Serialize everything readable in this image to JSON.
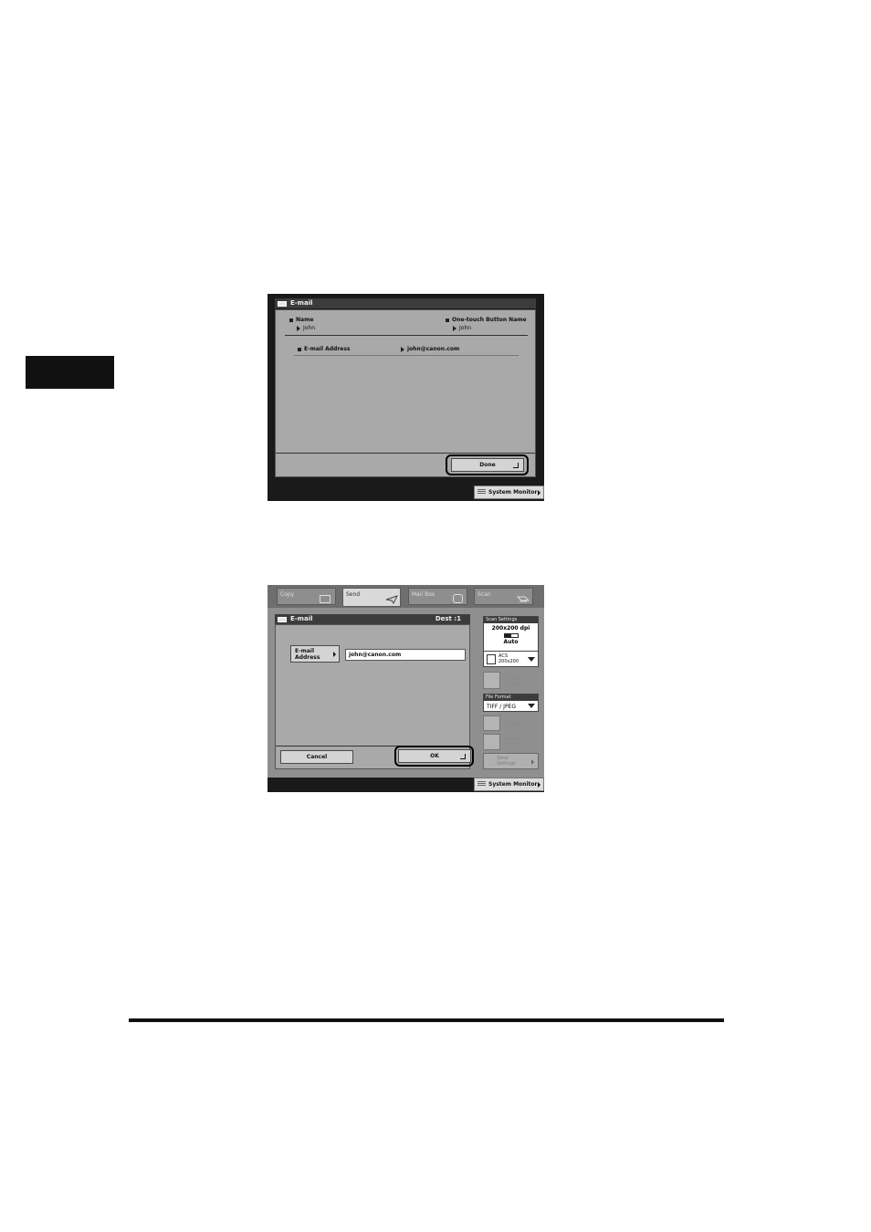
{
  "screen1": {
    "title": "E-mail",
    "name_label": "Name",
    "name_value": "John",
    "onetouch_label": "One-touch Button Name",
    "onetouch_value": "John",
    "email_label": "E-mail Address",
    "email_value": "john@canon.com",
    "done_label": "Done",
    "system_monitor": "System Monitor"
  },
  "screen2": {
    "tabs": [
      "Copy",
      "Send",
      "Mail Box",
      "Scan"
    ],
    "title": "E-mail",
    "dest": "Dest :1",
    "email_button_line1": "E-mail",
    "email_button_line2": "Address",
    "email_input_value": "john@canon.com",
    "cancel_label": "Cancel",
    "ok_label": "OK",
    "system_monitor": "System Monitor",
    "side": {
      "scan_settings_label": "Scan Settings",
      "resolution": "200x200 dpi",
      "color_mode": "Auto",
      "acs_line1": "ACS",
      "acs_line2": "200x200",
      "two_sided_line1": "2-Sided",
      "two_sided_line2": "Original",
      "file_format_label": "File Format",
      "file_format_value": "TIFF / JPEG",
      "preview_label": "Preview",
      "job_done_line1": "Job Done",
      "job_done_line2": "Notice",
      "send_settings_line1": "Send",
      "send_settings_line2": "Settings"
    }
  }
}
